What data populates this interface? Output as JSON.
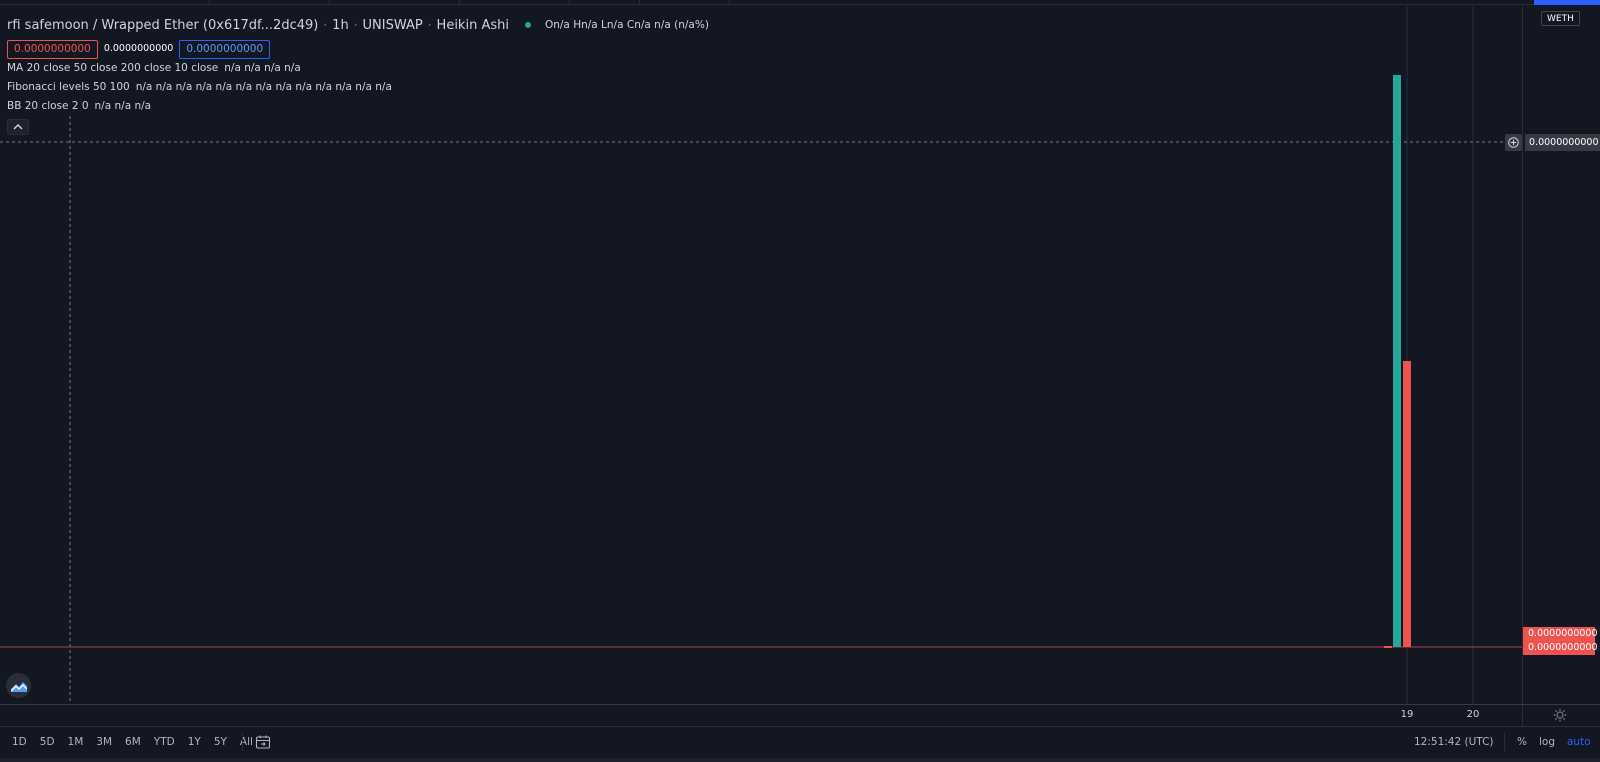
{
  "legend": {
    "symbol": "rfi safemoon / Wrapped Ether (0x617df...2dc49)",
    "interval": "1h",
    "exchange": "UNISWAP",
    "chart_style": "Heikin Ashi",
    "ohlc": "On/a Hn/a Ln/a Cn/a n/a (n/a%)"
  },
  "price_boxes": {
    "sell": "0.0000000000",
    "spread": "0.0000000000",
    "buy": "0.0000000000"
  },
  "studies": [
    {
      "name": "MA 20 close 50 close 200 close 10 close",
      "values": "n/a n/a n/a n/a"
    },
    {
      "name": "Fibonacci levels 50 100",
      "values": "n/a n/a n/a n/a n/a n/a n/a n/a n/a n/a n/a n/a n/a"
    },
    {
      "name": "BB 20 close 2 0",
      "values": "n/a n/a n/a"
    }
  ],
  "collapse_glyph": "^",
  "price_axis": {
    "symbol_tag": "WETH",
    "crosshair_price": "0.0000000000",
    "last_price_1": "0.0000000000",
    "last_price_2": "0.0000000000"
  },
  "time_axis": {
    "ticks": [
      "19",
      "20"
    ]
  },
  "bottom_bar": {
    "ranges": [
      "1D",
      "5D",
      "1M",
      "3M",
      "6M",
      "YTD",
      "1Y",
      "5Y",
      "All"
    ],
    "clock": "12:51:42 (UTC)",
    "modes": [
      "%",
      "log",
      "auto"
    ]
  },
  "colors": {
    "background": "#131722",
    "up": "#26a69a",
    "down": "#ef5350",
    "accent": "#2962ff",
    "grid": "#2a2e39"
  },
  "icons": {
    "plus": "plus-circle-icon",
    "gear": "gear-icon",
    "goto": "calendar-goto-icon",
    "logo": "tradingview-logo-icon"
  }
}
